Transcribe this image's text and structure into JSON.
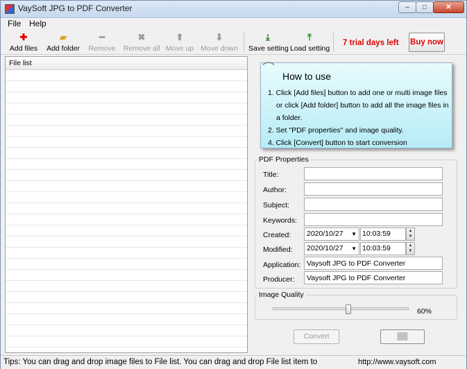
{
  "window": {
    "title": "VaySoft JPG to PDF Converter",
    "controls": {
      "minimize": "–",
      "maximize": "□",
      "close": "✕"
    }
  },
  "menu": {
    "items": [
      "File",
      "Help"
    ]
  },
  "toolbar": {
    "add_files": "Add files",
    "add_folder": "Add folder",
    "remove": "Remove",
    "remove_all": "Remove all",
    "move_up": "Move up",
    "move_down": "Move down",
    "save_setting": "Save setting",
    "load_setting": "Load setting",
    "trial": "7 trial days left",
    "buy_now": "Buy now",
    "icons": {
      "add_files": "plus-icon",
      "add_folder": "folder-icon",
      "remove": "minus-icon",
      "remove_all": "x-icon",
      "move_up": "arrow-up-icon",
      "move_down": "arrow-down-icon",
      "save_setting": "download-icon",
      "load_setting": "upload-icon"
    },
    "colors": {
      "add": "#e00000",
      "save_load": "#1a8a1a",
      "trial": "#e00000"
    }
  },
  "file_list": {
    "header": "File list"
  },
  "how_to": {
    "title": "How to use",
    "steps": [
      "1. Click [Add files] button to add one or multi image files or click [Add folder] button to add all the image files in a folder.",
      "2. Set \"PDF properties\" and image quality.",
      "4. Click [Convert] button to start conversion"
    ]
  },
  "pdf_properties": {
    "group_label": "PDF Properties",
    "title_label": "Title:",
    "author_label": "Author:",
    "subject_label": "Subject:",
    "keywords_label": "Keywords:",
    "created_label": "Created:",
    "created_date": "2020/10/27",
    "created_time": "10:03:59",
    "modified_label": "Modified:",
    "modified_date": "2020/10/27",
    "modified_time": "10:03:59",
    "application_label": "Application:",
    "application_value": "Vaysoft JPG to PDF Converter",
    "producer_label": "Producer:",
    "producer_value": "Vaysoft JPG to PDF Converter"
  },
  "image_quality": {
    "group_label": "Image Quality",
    "value": 60,
    "value_text": "60%"
  },
  "buttons": {
    "convert": "Convert"
  },
  "status": {
    "tips": "Tips: You can drag and drop image files to File list. You can drag and drop File list item to",
    "url": "http://www.vaysoft.com"
  }
}
